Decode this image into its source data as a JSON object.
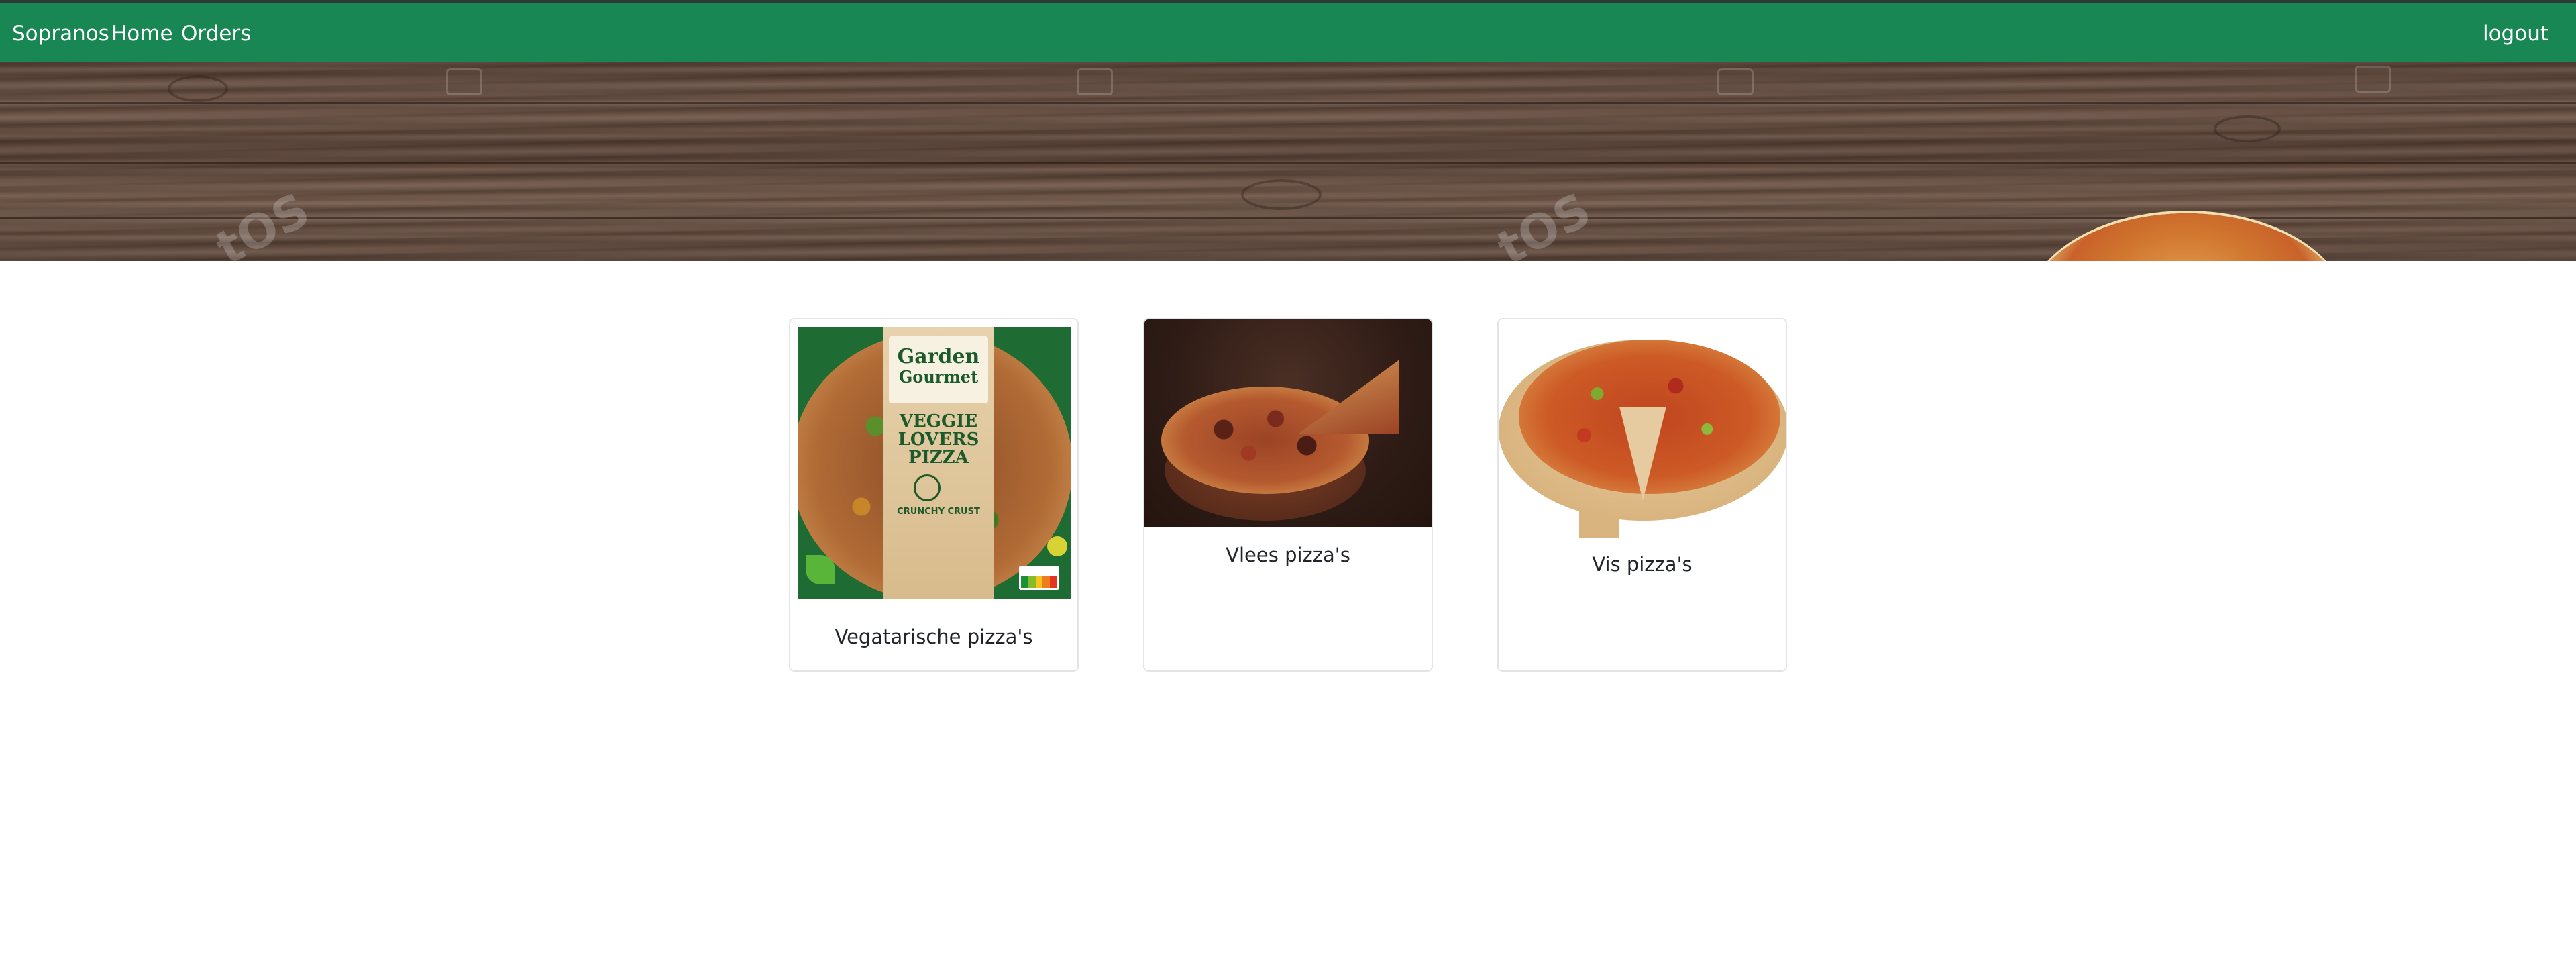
{
  "navbar": {
    "brand": "Sopranos",
    "links": [
      "Home",
      "Orders"
    ],
    "logout": "logout",
    "color": "#198754"
  },
  "hero": {
    "description": "wood-texture banner",
    "watermark": "tOS"
  },
  "cards": [
    {
      "title": "Vegatarische pizza's",
      "package": {
        "brand_line1": "Garden",
        "brand_line2": "Gourmet",
        "product": "VEGGIE LOVERS PIZZA",
        "subtitle": "CRUNCHY CRUST"
      }
    },
    {
      "title": "Vlees pizza's"
    },
    {
      "title": "Vis pizza's"
    }
  ]
}
